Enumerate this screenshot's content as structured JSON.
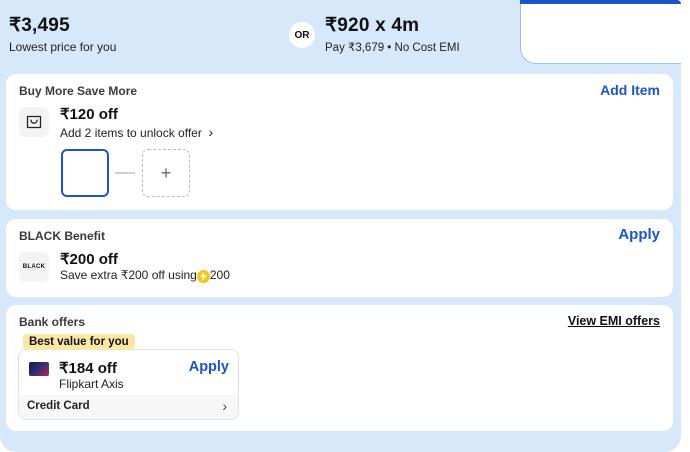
{
  "header": {
    "price": "₹3,495",
    "price_caption": "Lowest price for you",
    "or_label": "OR",
    "emi_price": "₹920 x 4m",
    "emi_caption": "Pay ₹3,679 • No Cost EMI"
  },
  "buy_more": {
    "title": "Buy More Save More",
    "action": "Add Item",
    "offer": "₹120 off",
    "subtext": "Add 2 items to unlock offer",
    "chevron": "›",
    "add_slot": "+"
  },
  "black_benefit": {
    "title": "BLACK Benefit",
    "action": "Apply",
    "logo_text": "BLACK",
    "offer": "₹200 off",
    "subtext_prefix": "Save extra ₹200 off using",
    "subtext_suffix": "200"
  },
  "bank_offers": {
    "title": "Bank offers",
    "action": "View EMI offers",
    "badge": "Best value for you",
    "offer": "₹184 off",
    "bank_name": "Flipkart Axis",
    "apply": "Apply",
    "card_type": "Credit Card",
    "chevron": "›"
  },
  "colors": {
    "accent": "#1b54c9",
    "panel": "#d7e8fb",
    "badge": "#fbe7a6"
  }
}
